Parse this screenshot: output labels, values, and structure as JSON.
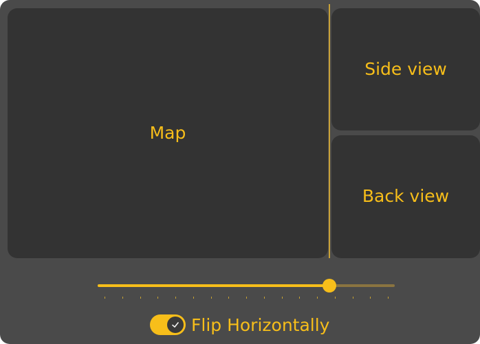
{
  "panels": {
    "map": {
      "label": "Map"
    },
    "side_view": {
      "label": "Side view"
    },
    "back_view": {
      "label": "Back view"
    }
  },
  "slider": {
    "value": 0.78,
    "tick_count": 17
  },
  "flip_toggle": {
    "label": "Flip Horizontally",
    "checked": true,
    "icon": "check-icon"
  },
  "colors": {
    "accent": "#f7be1a",
    "panel_bg": "#333333",
    "window_bg": "#4a4a4a"
  }
}
